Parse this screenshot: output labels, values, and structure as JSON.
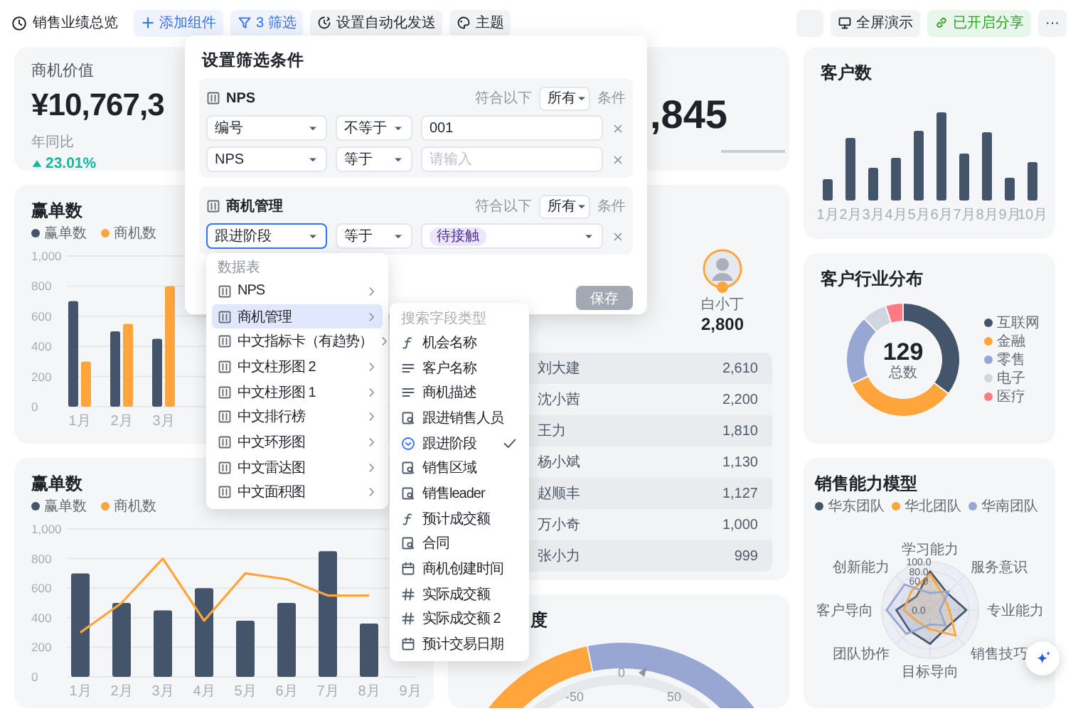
{
  "topbar": {
    "title": "销售业绩总览",
    "buttons": [
      {
        "kind": "add",
        "label": "添加组件"
      },
      {
        "kind": "filter",
        "label": "3 筛选"
      },
      {
        "kind": "automation",
        "label": "设置自动化发送"
      },
      {
        "kind": "theme",
        "label": "主题"
      }
    ],
    "right_buttons": [
      {
        "kind": "blank"
      },
      {
        "kind": "present",
        "label": "全屏演示"
      },
      {
        "kind": "share",
        "label": "已开启分享"
      },
      {
        "kind": "more",
        "label": "···"
      }
    ]
  },
  "opportunity_value": {
    "label": "商机价值",
    "value": "¥10,767,3",
    "compare_label": "年同比",
    "change": "23.01%",
    "up": true
  },
  "kpi_2": {
    "value": ",845"
  },
  "wins_chart": {
    "title": "赢单数",
    "chart_data": {
      "type": "bar",
      "categories": [
        "1月",
        "2月",
        "3月"
      ],
      "series": [
        {
          "name": "赢单数",
          "color": "#44546a",
          "values": [
            700,
            500,
            450
          ]
        },
        {
          "name": "商机数",
          "color": "#ffa53b",
          "values": [
            300,
            550,
            800
          ]
        }
      ],
      "ylim": [
        0,
        1000
      ],
      "yticks": [
        0,
        200,
        400,
        600,
        800,
        {
          "value": 1000,
          "label": "1,000"
        }
      ],
      "grid": true
    }
  },
  "wins_trend": {
    "title": "赢单数",
    "chart_data": {
      "type": "bar",
      "categories": [
        "1月",
        "2月",
        "3月",
        "4月",
        "5月",
        "6月",
        "7月",
        "8月",
        "9月"
      ],
      "series": [
        {
          "name": "赢单数",
          "type": "bar",
          "color": "#44546a",
          "values": [
            700,
            500,
            450,
            600,
            380,
            500,
            850,
            360,
            null
          ]
        },
        {
          "name": "商机数",
          "type": "line",
          "color": "#ffa53b",
          "values": [
            300,
            500,
            800,
            380,
            700,
            660,
            550,
            550,
            null
          ]
        }
      ],
      "ylim": [
        0,
        1000
      ],
      "yticks": [
        0,
        200,
        400,
        600,
        800,
        {
          "value": 1000,
          "label": "1,000"
        }
      ],
      "grid": true
    }
  },
  "ranking": {
    "leader": {
      "name": "白小丁",
      "value": "2,800"
    },
    "rows": [
      {
        "name": "刘大建",
        "value": "2,610"
      },
      {
        "name": "沈小茜",
        "value": "2,200"
      },
      {
        "name": "王力",
        "value": "1,810"
      },
      {
        "name": "杨小斌",
        "value": "1,130"
      },
      {
        "name": "赵顺丰",
        "value": "1,127"
      },
      {
        "name": "万小奇",
        "value": "1,000"
      },
      {
        "name": "张小力",
        "value": "999"
      }
    ]
  },
  "gauge": {
    "title": "度",
    "ticks": [
      "-50",
      "0",
      "50"
    ]
  },
  "customer_count": {
    "title": "客户数",
    "x_labels": [
      "1月",
      "2月",
      "3月",
      "4月",
      "5月",
      "6月",
      "7月",
      "8月",
      "9月",
      "10月"
    ]
  },
  "industry": {
    "title": "客户行业分布",
    "total": "129",
    "total_label": "总数",
    "legend": [
      {
        "name": "互联网",
        "color": "#44546a"
      },
      {
        "name": "金融",
        "color": "#ffa53b"
      },
      {
        "name": "零售",
        "color": "#98a6d4"
      },
      {
        "name": "电子",
        "color": "#d0d6de"
      },
      {
        "name": "医疗",
        "color": "#ff7b83"
      }
    ]
  },
  "radar": {
    "title": "销售能力模型",
    "legend": [
      {
        "name": "华东团队",
        "color": "#44546a"
      },
      {
        "name": "华北团队",
        "color": "#ffa53b"
      },
      {
        "name": "华南团队",
        "color": "#98a6d4"
      }
    ],
    "axes": [
      "学习能力",
      "创新能力",
      "服务意识",
      "客户导向",
      "专业能力",
      "团队协作",
      "销售技巧",
      "目标导向"
    ],
    "ticks": [
      "100.0",
      "80.0",
      "60.0",
      "0.0"
    ]
  },
  "filter": {
    "title": "设置筛选条件",
    "groups": [
      {
        "table": "NPS",
        "match_prefix": "符合以下",
        "match": "所有",
        "match_suffix": "条件",
        "rows": [
          {
            "field": "编号",
            "focused": false,
            "operator": "不等于",
            "kind": "text",
            "value": "001"
          },
          {
            "field": "NPS",
            "focused": false,
            "operator": "等于",
            "kind": "empty",
            "placeholder": "请输入"
          }
        ]
      },
      {
        "table": "商机管理",
        "match_prefix": "符合以下",
        "match": "所有",
        "match_suffix": "条件",
        "rows": [
          {
            "field": "跟进阶段",
            "focused": true,
            "operator": "等于",
            "kind": "tag",
            "value": "待接触"
          }
        ]
      }
    ],
    "save": {
      "label": "保存",
      "disabled": true
    }
  },
  "table_menu": {
    "header": "数据表",
    "items": [
      {
        "label": "NPS",
        "selected": false
      },
      {
        "label": "商机管理",
        "selected": true
      },
      {
        "label": "中文指标卡（有趋势）",
        "selected": false
      },
      {
        "label": "中文柱形图 2",
        "selected": false
      },
      {
        "label": "中文柱形图 1",
        "selected": false
      },
      {
        "label": "中文排行榜",
        "selected": false
      },
      {
        "label": "中文环形图",
        "selected": false
      },
      {
        "label": "中文雷达图",
        "selected": false
      },
      {
        "label": "中文面积图",
        "selected": false
      }
    ]
  },
  "field_menu": {
    "placeholder": "搜索字段类型",
    "items": [
      {
        "kind": "formula",
        "label": "机会名称",
        "checked": false
      },
      {
        "kind": "text",
        "label": "客户名称",
        "checked": false
      },
      {
        "kind": "text",
        "label": "商机描述",
        "checked": false
      },
      {
        "kind": "lookup",
        "label": "跟进销售人员",
        "checked": false
      },
      {
        "kind": "select",
        "label": "跟进阶段",
        "checked": true
      },
      {
        "kind": "lookup",
        "label": "销售区域",
        "checked": false
      },
      {
        "kind": "lookup",
        "label": "销售leader",
        "checked": false
      },
      {
        "kind": "formula",
        "label": "预计成交额",
        "checked": false
      },
      {
        "kind": "lookup",
        "label": "合同",
        "checked": false
      },
      {
        "kind": "date",
        "label": "商机创建时间",
        "checked": false
      },
      {
        "kind": "number",
        "label": "实际成交额",
        "checked": false
      },
      {
        "kind": "number",
        "label": "实际成交额 2",
        "checked": false
      },
      {
        "kind": "date",
        "label": "预计交易日期",
        "checked": false
      }
    ]
  }
}
